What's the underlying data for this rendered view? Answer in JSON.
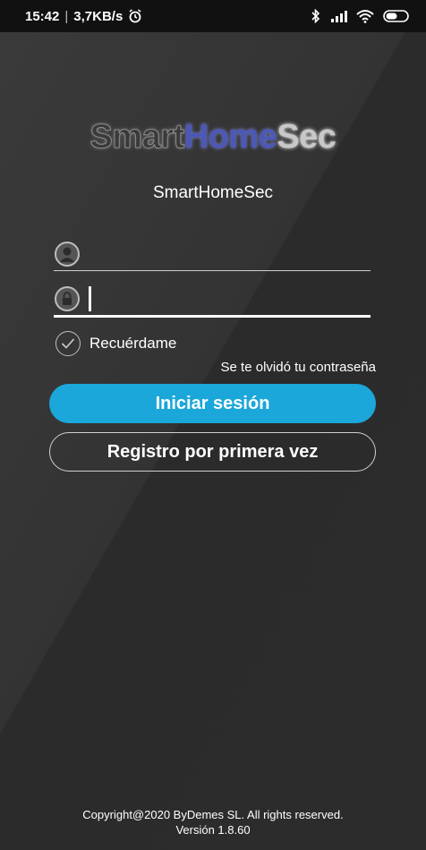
{
  "status_bar": {
    "time": "15:42",
    "separator": "|",
    "network_speed": "3,7KB/s",
    "icons": [
      "alarm-icon",
      "bluetooth-icon",
      "signal-icon",
      "wifi-icon",
      "battery-icon"
    ]
  },
  "brand": {
    "logo_part1": "Smart",
    "logo_part2": "Home",
    "logo_part3": "Sec",
    "app_name": "SmartHomeSec",
    "colors": {
      "primary": "#1ba7d9",
      "logo_home": "#4c58b8"
    }
  },
  "login_form": {
    "username": {
      "value": "",
      "placeholder": ""
    },
    "password": {
      "value": "",
      "placeholder": ""
    },
    "remember_label": "Recuérdame",
    "remember_checked": true,
    "forgot_label": "Se te olvidó tu contraseña",
    "login_button": "Iniciar sesión",
    "register_button": "Registro por primera vez"
  },
  "footer": {
    "copyright": "Copyright@2020 ByDemes SL. All rights reserved.",
    "version": "Versión 1.8.60"
  }
}
